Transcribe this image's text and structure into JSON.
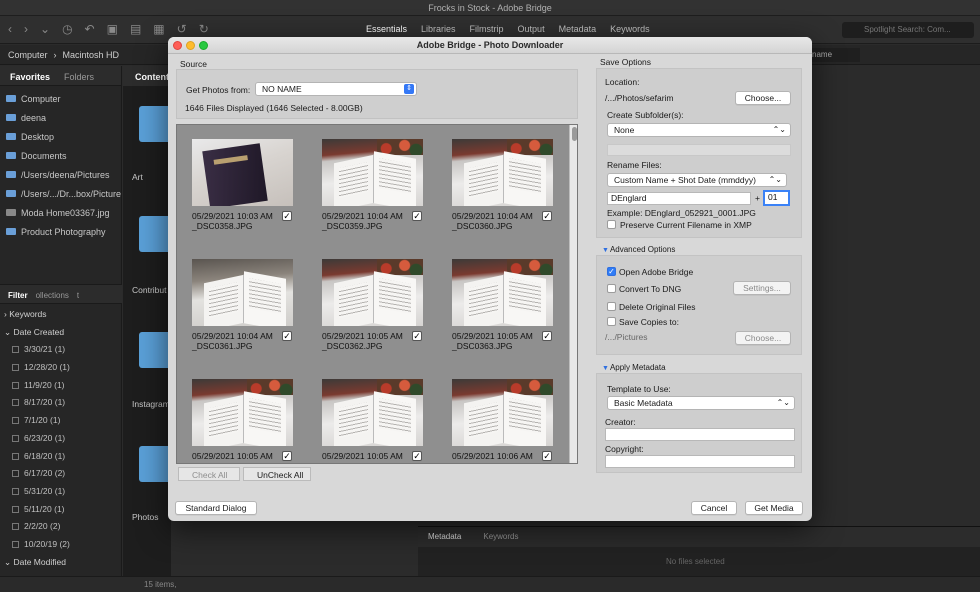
{
  "app": {
    "window_title": "Frocks in Stock - Adobe Bridge",
    "workspaces": [
      "Essentials",
      "Libraries",
      "Filmstrip",
      "Output",
      "Metadata",
      "Keywords"
    ],
    "active_workspace": "Essentials",
    "search_placeholder": "Spotlight Search: Com...",
    "path": [
      "Computer",
      "Macintosh HD"
    ],
    "sort_label": "ilename",
    "left_tabs": [
      "Favorites",
      "Folders"
    ],
    "favorites": [
      "Computer",
      "deena",
      "Desktop",
      "Documents",
      "/Users/deena/Pictures",
      "/Users/.../Dr...box/Pictures",
      "Moda Home03367.jpg",
      "Product Photography"
    ],
    "filter_tabs": [
      "Filter",
      "ollections",
      "t"
    ],
    "filter": {
      "keywords": "Keywords",
      "date_created": "Date Created",
      "dates": [
        {
          "date": "3/30/21",
          "count": "(1)"
        },
        {
          "date": "12/28/20",
          "count": "(1)"
        },
        {
          "date": "11/9/20",
          "count": "(1)"
        },
        {
          "date": "8/17/20",
          "count": "(1)"
        },
        {
          "date": "7/1/20",
          "count": "(1)"
        },
        {
          "date": "6/23/20",
          "count": "(1)"
        },
        {
          "date": "6/18/20",
          "count": "(1)"
        },
        {
          "date": "6/17/20",
          "count": "(2)"
        },
        {
          "date": "5/31/20",
          "count": "(1)"
        },
        {
          "date": "5/11/20",
          "count": "(1)"
        },
        {
          "date": "2/2/20",
          "count": "(2)"
        },
        {
          "date": "10/20/19",
          "count": "(2)"
        }
      ],
      "date_modified": "Date Modified"
    },
    "content_tab": "Content",
    "folders": [
      "Art",
      "Contribut",
      "Instagram",
      "Photos"
    ],
    "meta_tabs": [
      "Metadata",
      "Keywords"
    ],
    "no_files": "No files selected",
    "items_count": "15 items,"
  },
  "dialog": {
    "title": "Adobe Bridge - Photo Downloader",
    "source_label": "Source",
    "get_photos_label": "Get Photos from:",
    "get_photos_value": "NO NAME",
    "files_summary": "1646 Files Displayed (1646 Selected - 8.00GB)",
    "thumbs": [
      {
        "date": "05/29/2021 10:03 AM",
        "file": "_DSC0358.JPG",
        "checked": true
      },
      {
        "date": "05/29/2021 10:04 AM",
        "file": "_DSC0359.JPG",
        "checked": true
      },
      {
        "date": "05/29/2021 10:04 AM",
        "file": "_DSC0360.JPG",
        "checked": true
      },
      {
        "date": "05/29/2021 10:04 AM",
        "file": "_DSC0361.JPG",
        "checked": true
      },
      {
        "date": "05/29/2021 10:05 AM",
        "file": "_DSC0362.JPG",
        "checked": true
      },
      {
        "date": "05/29/2021 10:05 AM",
        "file": "_DSC0363.JPG",
        "checked": true
      },
      {
        "date": "05/29/2021 10:05 AM",
        "file": "",
        "checked": true
      },
      {
        "date": "05/29/2021 10:05 AM",
        "file": "",
        "checked": true
      },
      {
        "date": "05/29/2021 10:06 AM",
        "file": "",
        "checked": true
      }
    ],
    "check_all": "Check All",
    "uncheck_all": "UnCheck All",
    "save_options": "Save Options",
    "location_label": "Location:",
    "location_value": "/.../Photos/sefarim",
    "choose": "Choose...",
    "create_subfolders_label": "Create Subfolder(s):",
    "create_subfolders_value": "None",
    "rename_files_label": "Rename Files:",
    "rename_files_value": "Custom Name + Shot Date (mmddyy)",
    "custom_name": "DEnglard",
    "plus": "+",
    "sequence": "01",
    "example": "Example:  DEnglard_052921_0001.JPG",
    "preserve_label": "Preserve Current Filename in XMP",
    "advanced_options": "Advanced Options",
    "open_bridge": "Open Adobe Bridge",
    "convert_dng": "Convert To DNG",
    "settings": "Settings...",
    "delete_originals": "Delete Original Files",
    "save_copies": "Save Copies to:",
    "copies_path": "/.../Pictures",
    "choose2": "Choose...",
    "apply_metadata": "Apply Metadata",
    "template_label": "Template to Use:",
    "template_value": "Basic Metadata",
    "creator_label": "Creator:",
    "copyright_label": "Copyright:",
    "standard_dialog": "Standard Dialog",
    "cancel": "Cancel",
    "get_media": "Get Media"
  }
}
